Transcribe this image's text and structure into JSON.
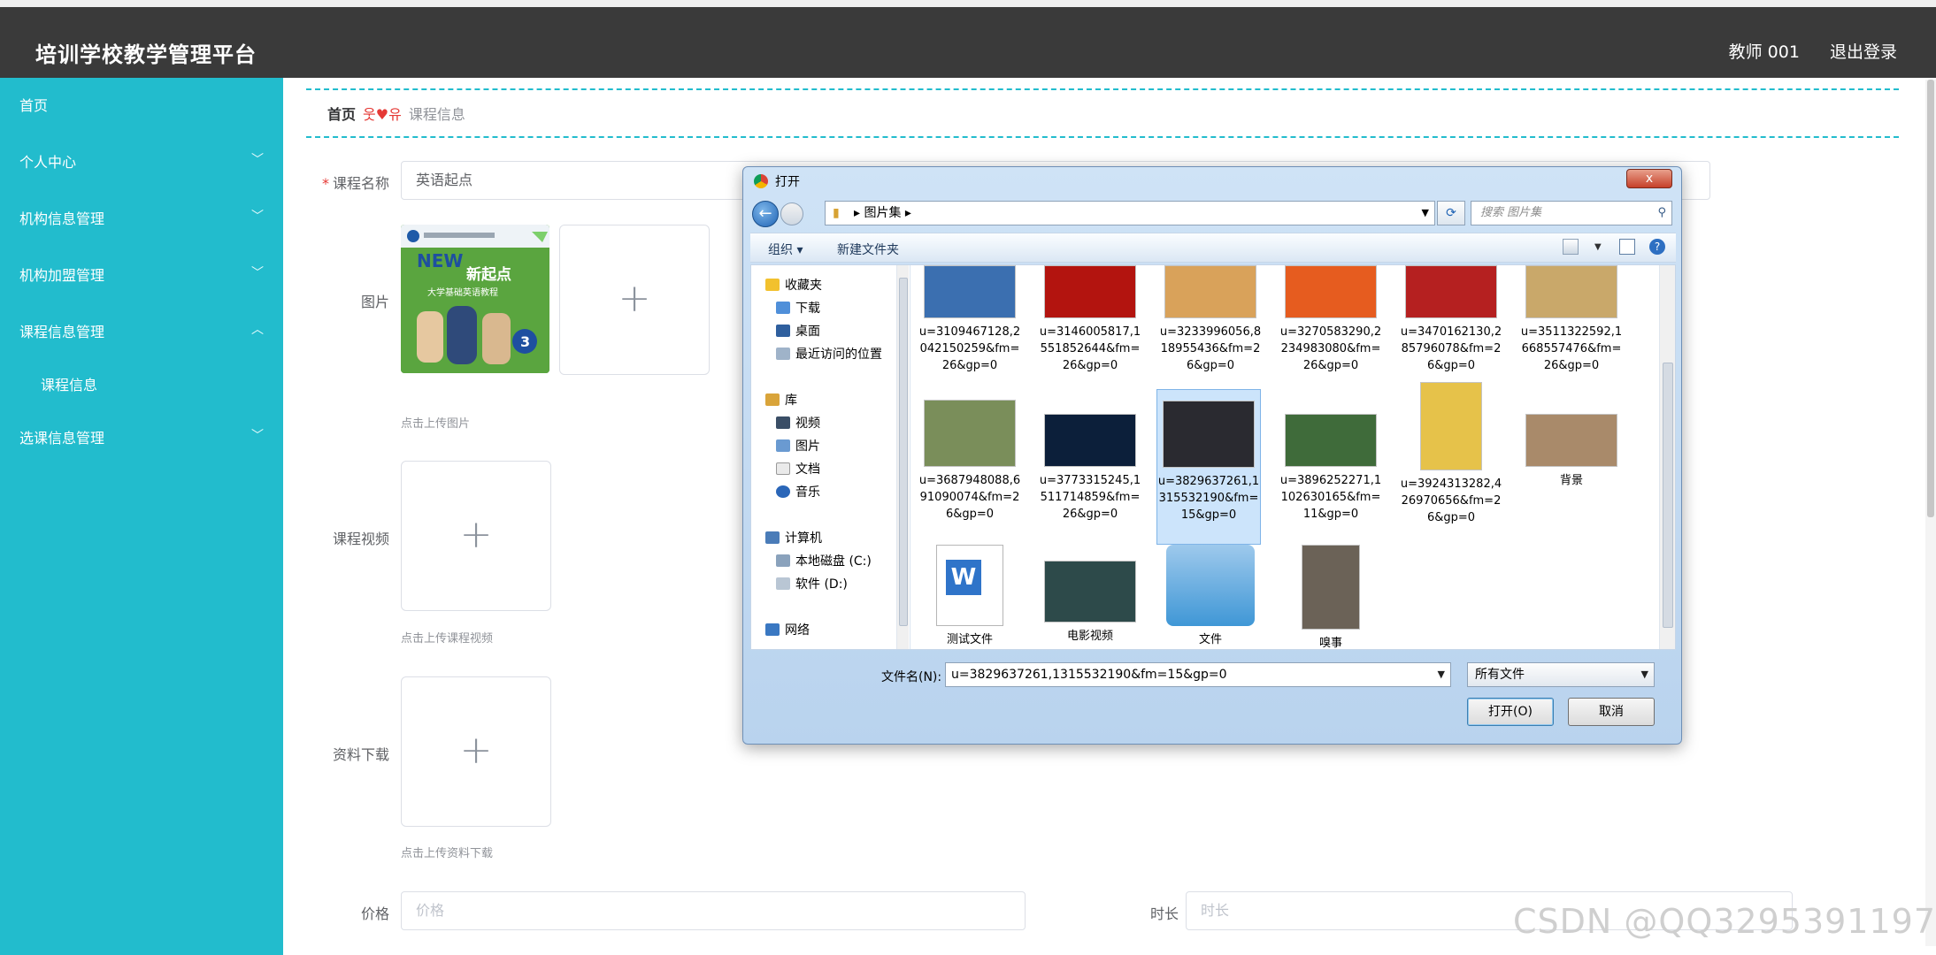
{
  "header": {
    "title": "培训学校教学管理平台",
    "user": "教师 001",
    "logout": "退出登录"
  },
  "sidebar": {
    "items": [
      {
        "label": "首页",
        "expandable": false
      },
      {
        "label": "个人中心",
        "expandable": true
      },
      {
        "label": "机构信息管理",
        "expandable": true
      },
      {
        "label": "机构加盟管理",
        "expandable": true
      },
      {
        "label": "课程信息管理",
        "expandable": true,
        "expanded": true
      },
      {
        "label": "课程信息",
        "sub": true
      },
      {
        "label": "选课信息管理",
        "expandable": true
      }
    ]
  },
  "breadcrumb": {
    "home": "首页",
    "sep": "웃♥유",
    "current": "课程信息"
  },
  "form": {
    "course_name_label": "课程名称",
    "course_name_value": "英语起点",
    "image_label": "图片",
    "image_hint": "点击上传图片",
    "book_cover": {
      "brand": "NEW",
      "title": "新起点",
      "subtitle": "大学基础英语教程"
    },
    "video_label": "课程视频",
    "video_hint": "点击上传课程视频",
    "material_label": "资料下载",
    "material_hint": "点击上传资料下载",
    "price_label": "价格",
    "price_placeholder": "价格",
    "duration_label": "时长",
    "duration_placeholder": "时长",
    "plus_glyph": "+"
  },
  "dialog": {
    "title": "打开",
    "close": "x",
    "path": [
      "图片集"
    ],
    "search_placeholder": "搜索 图片集",
    "toolbar": {
      "organize": "组织 ▾",
      "new_folder": "新建文件夹"
    },
    "nav": {
      "favorites": "收藏夹",
      "favorites_items": [
        "下载",
        "桌面",
        "最近访问的位置"
      ],
      "library": "库",
      "library_items": [
        "视频",
        "图片",
        "文档",
        "音乐"
      ],
      "computer": "计算机",
      "computer_items": [
        "本地磁盘 (C:)",
        "软件 (D:)"
      ],
      "network": "网络"
    },
    "files": [
      {
        "name": "u=3109467128,2042150259&fm=26&gp=0",
        "color": "#3b6fb0"
      },
      {
        "name": "u=3146005817,1551852644&fm=26&gp=0",
        "color": "#b3140f"
      },
      {
        "name": "u=3233996056,818955436&fm=26&gp=0",
        "color": "#d9a25a"
      },
      {
        "name": "u=3270583290,2234983080&fm=26&gp=0",
        "color": "#e65c1f"
      },
      {
        "name": "u=3470162130,285796078&fm=26&gp=0",
        "color": "#b52020"
      },
      {
        "name": "u=3511322592,1668557476&fm=26&gp=0",
        "color": "#c9a86a"
      },
      {
        "name": "u=3687948088,691090074&fm=26&gp=0",
        "color": "#7a8e5a"
      },
      {
        "name": "u=3773315245,1511714859&fm=26&gp=0",
        "color": "#0c1f3a"
      },
      {
        "name": "u=3829637261,1315532190&fm=15&gp=0",
        "color": "#2a2a30",
        "selected": true
      },
      {
        "name": "u=3896252271,1102630165&fm=11&gp=0",
        "color": "#3f6b3a"
      },
      {
        "name": "u=3924313282,426970656&fm=26&gp=0",
        "color": "#e6c24a"
      },
      {
        "name": "背景",
        "color": "#a98a6a"
      },
      {
        "name": "测试文件",
        "color": "#ffffff",
        "kind": "word"
      },
      {
        "name": "电影视频",
        "color": "#2d4a4a",
        "kind": "video"
      },
      {
        "name": "文件",
        "color": "#3f97d6",
        "kind": "archive"
      },
      {
        "name": "嗅事",
        "color": "#6b6257",
        "kind": "video"
      }
    ],
    "filename_label": "文件名(N):",
    "filename_value": "u=3829637261,1315532190&fm=15&gp=0",
    "filetype": "所有文件",
    "open_button": "打开(O)",
    "cancel_button": "取消"
  },
  "watermark": "CSDN @QQ3295391197"
}
